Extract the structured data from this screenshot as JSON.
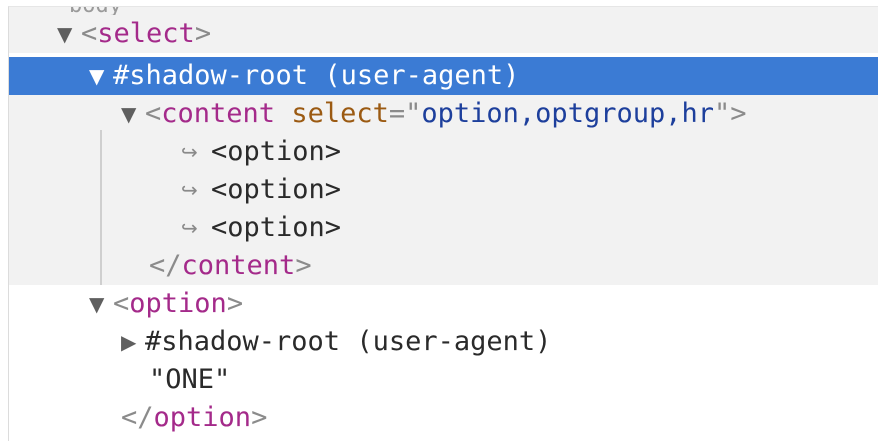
{
  "tree": {
    "top_cut": "body",
    "select_open": {
      "lt": "<",
      "name": "select",
      "gt": ">"
    },
    "shadow_root": {
      "text": "#shadow-root (user-agent)"
    },
    "content_open": {
      "lt": "<",
      "name": "content",
      "attr_name": "select",
      "eq": "=\"",
      "attr_value": "option,optgroup,hr",
      "end_quote": "\"",
      "gt": ">"
    },
    "reveal_items": [
      {
        "arrow": "↪",
        "label": "<option>"
      },
      {
        "arrow": "↪",
        "label": "<option>"
      },
      {
        "arrow": "↪",
        "label": "<option>"
      }
    ],
    "content_close": {
      "lt": "</",
      "name": "content",
      "gt": ">"
    },
    "option_open": {
      "lt": "<",
      "name": "option",
      "gt": ">"
    },
    "option_shadow_root": {
      "text": "#shadow-root (user-agent)"
    },
    "option_text": "\"ONE\"",
    "option_close": {
      "lt": "</",
      "name": "option",
      "gt": ">"
    }
  },
  "icons": {
    "expanded": "▼",
    "collapsed": "▶"
  },
  "colors": {
    "selection": "#3b7bd4",
    "shaded_rows": "#f2f2f2",
    "tag": "#a42a8a",
    "attribute_name": "#9b5a12",
    "attribute_value": "#1d3f9c"
  }
}
